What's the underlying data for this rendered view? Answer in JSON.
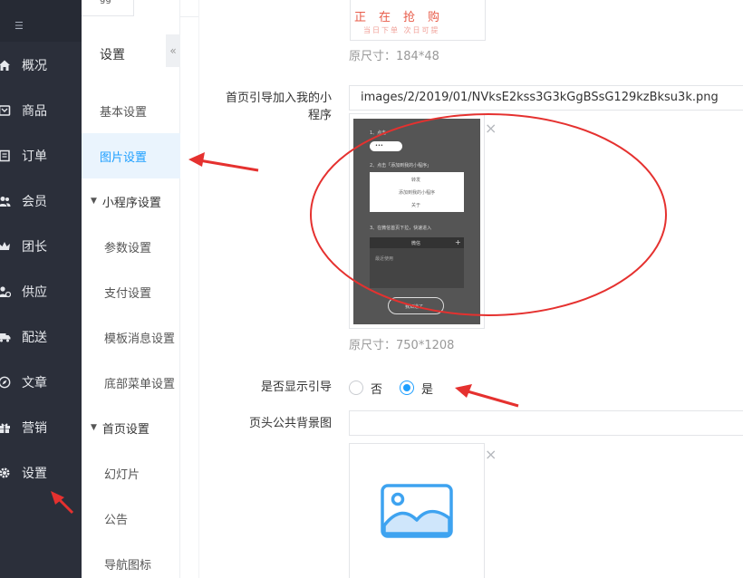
{
  "nav": {
    "items": [
      {
        "label": "概况",
        "icon": "home-icon"
      },
      {
        "label": "商品",
        "icon": "product-icon"
      },
      {
        "label": "订单",
        "icon": "order-icon"
      },
      {
        "label": "会员",
        "icon": "members-icon"
      },
      {
        "label": "团长",
        "icon": "crown-icon"
      },
      {
        "label": "供应",
        "icon": "supply-icon"
      },
      {
        "label": "配送",
        "icon": "truck-icon"
      },
      {
        "label": "文章",
        "icon": "compass-icon"
      },
      {
        "label": "营销",
        "icon": "gift-icon"
      },
      {
        "label": "设置",
        "icon": "gear-icon"
      }
    ],
    "active_index": 9
  },
  "tab": {
    "label": "gg"
  },
  "subnav": {
    "title": "设置",
    "collapse_glyph": "«",
    "items": [
      {
        "label": "基本设置"
      },
      {
        "label": "图片设置"
      },
      {
        "label": "小程序设置"
      },
      {
        "label": "参数设置"
      },
      {
        "label": "支付设置"
      },
      {
        "label": "模板消息设置"
      },
      {
        "label": "底部菜单设置"
      },
      {
        "label": "首页设置"
      },
      {
        "label": "幻灯片"
      },
      {
        "label": "公告"
      },
      {
        "label": "导航图标"
      }
    ],
    "active_index": 1
  },
  "form": {
    "stamp_image": {
      "big_text": "正在抢购",
      "small_text": "当日下单  次日可提",
      "size_note": "原尺寸：184*48"
    },
    "guide_field": {
      "label_line1": "首页引导加入我的小",
      "label_line2": "程序",
      "value": "images/2/2019/01/NVksE2kss3G3kGgBSsG129kzBksu3k.png",
      "size_note": "原尺寸：750*1208",
      "remove_glyph": "×",
      "preview": {
        "step1": "1、点击",
        "pill_text": "•••",
        "step2": "2、点击「添加到我的小程序」",
        "menu_items": [
          "转发",
          "添加到我的小程序",
          "关于"
        ],
        "step3": "3、在微信首页下拉，快速进入",
        "panel_title": "微信",
        "panel_plus": "+",
        "panel_sub": "最近使用",
        "button_text": "我知道了"
      }
    },
    "show_guide": {
      "label": "是否显示引导",
      "options": [
        "否",
        "是"
      ],
      "selected_index": 1
    },
    "header_bg": {
      "label": "页头公共背景图",
      "value": "",
      "remove_glyph": "×"
    }
  },
  "colors": {
    "nav_bg": "#2b2f3a",
    "accent": "#1e9fff",
    "annotation": "#e5312f"
  }
}
